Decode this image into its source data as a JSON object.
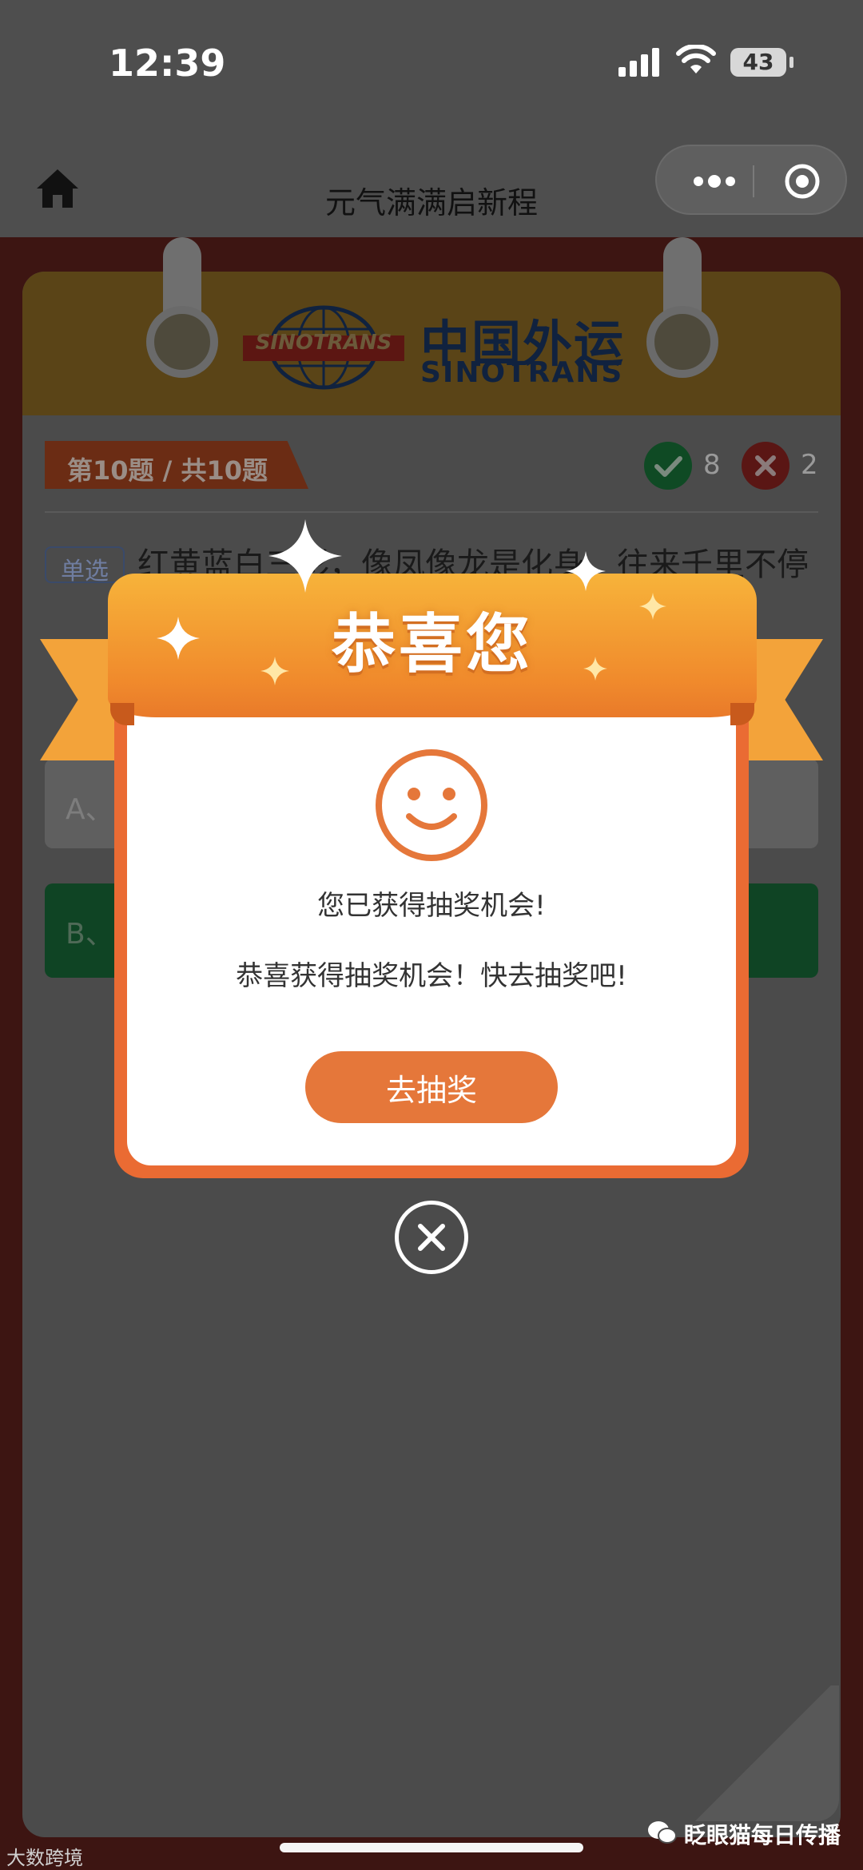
{
  "status_bar": {
    "time": "12:39",
    "battery": "43"
  },
  "nav": {
    "title": "元气满满启新程"
  },
  "brand": {
    "name_cn": "中国外运",
    "name_en": "SINOTRANS",
    "globe_text": "SINOTRANS"
  },
  "quiz": {
    "progress": "第10题 / 共10题",
    "correct_count": "8",
    "wrong_count": "2",
    "type": "单选",
    "question": "红黄蓝白三彩，像凤像龙是化身，往来千里不停",
    "option_a": "A、",
    "option_b": "B、"
  },
  "modal": {
    "title": "恭喜您",
    "message_1": "您已获得抽奖机会!",
    "message_2": "恭喜获得抽奖机会！快去抽奖吧!",
    "button": "去抽奖"
  },
  "watermark": {
    "left": "大数跨境",
    "right": "眨眼猫每日传播"
  },
  "colors": {
    "ribbon": "#f08a2c",
    "modal_border": "#ea6b33",
    "button": "#e5773a"
  }
}
